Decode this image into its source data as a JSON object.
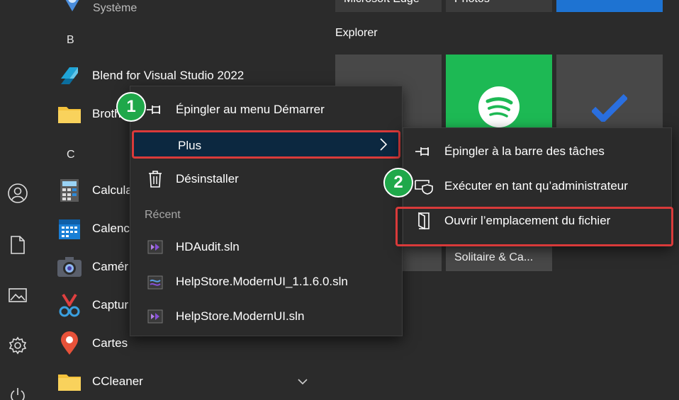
{
  "applist": {
    "systeme_sub": "Système",
    "letter_b": "B",
    "letter_c": "C",
    "apps": {
      "blend": "Blend for Visual Studio 2022",
      "brother": "Broth",
      "calculator": "Calcula",
      "calendar": "Calenc",
      "camera": "Camér",
      "capture": "Captur",
      "cartes": "Cartes",
      "ccleaner": "CCleaner"
    }
  },
  "tiles": {
    "edge_label": "Microsoft Edge",
    "photos_label": "Photos",
    "explorer_header": "Explorer",
    "solitaire_label": "Solitaire & Ca..."
  },
  "context_menu": {
    "pin_start": "Épingler au menu Démarrer",
    "plus": "Plus",
    "uninstall": "Désinstaller",
    "recent_header": "Récent",
    "recent": [
      "HDAudit.sln",
      "HelpStore.ModernUI_1.1.6.0.sln",
      "HelpStore.ModernUI.sln"
    ]
  },
  "submenu": {
    "pin_taskbar": "Épingler à la barre des tâches",
    "run_admin": "Exécuter en tant qu’administrateur",
    "open_location": "Ouvrir l’emplacement du fichier"
  },
  "badges": {
    "step1": "1",
    "step2": "2"
  },
  "colors": {
    "highlight_border": "#d93a3a",
    "badge_green": "#1fa84a",
    "spotify_green": "#1db954",
    "menu_bg": "#2b2b2b",
    "plus_bg": "#0c2840"
  }
}
